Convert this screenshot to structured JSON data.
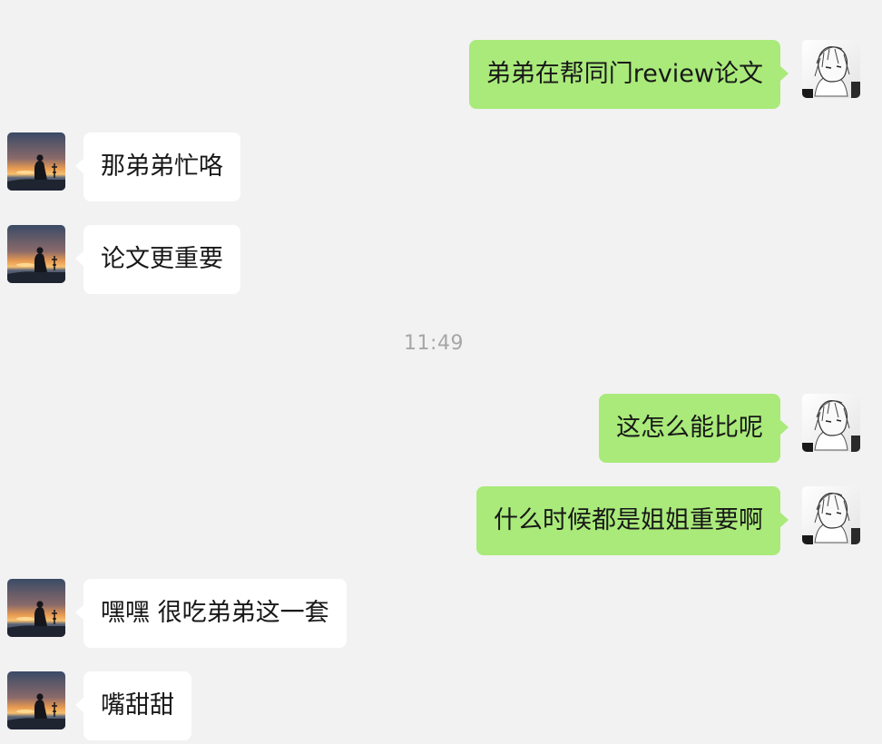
{
  "conversation": {
    "messages": [
      {
        "side": "out",
        "text": "弟弟在帮同门review论文"
      },
      {
        "side": "in",
        "text": "那弟弟忙咯"
      },
      {
        "side": "in",
        "text": "论文更重要"
      },
      {
        "side": "out",
        "text": "这怎么能比呢"
      },
      {
        "side": "out",
        "text": "什么时候都是姐姐重要啊"
      },
      {
        "side": "in",
        "text": "嘿嘿 很吃弟弟这一套"
      },
      {
        "side": "in",
        "text": "嘴甜甜"
      }
    ],
    "timestamp": "11:49"
  },
  "colors": {
    "background": "#f2f2f2",
    "incoming_bubble": "#ffffff",
    "outgoing_bubble": "#a9ea7a",
    "timestamp_text": "#a6a6a6"
  },
  "icons": {
    "incoming_avatar": "sunset-silhouette-avatar-icon",
    "outgoing_avatar": "anime-sketch-avatar-icon"
  }
}
